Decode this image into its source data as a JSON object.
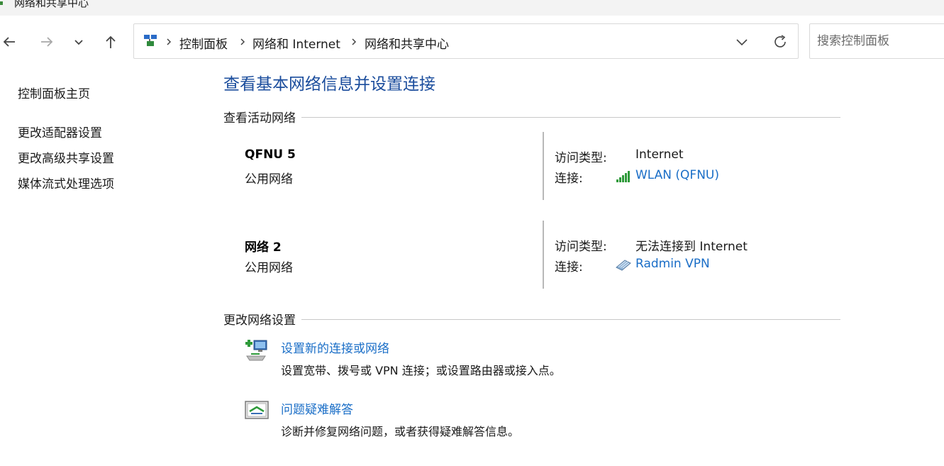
{
  "window": {
    "title": "网络和共享中心",
    "icon": "network-center-icon"
  },
  "nav": {
    "back_icon": "arrow-left-icon",
    "forward_icon": "arrow-right-icon",
    "recent_icon": "chevron-down-icon",
    "up_icon": "arrow-up-icon"
  },
  "address": {
    "icon": "control-panel-icon",
    "crumbs": [
      "控制面板",
      "网络和 Internet",
      "网络和共享中心"
    ],
    "dropdown_icon": "chevron-down-icon",
    "refresh_icon": "refresh-icon"
  },
  "search": {
    "placeholder": "搜索控制面板",
    "value": ""
  },
  "sidebar": {
    "home": "控制面板主页",
    "items": [
      "更改适配器设置",
      "更改高级共享设置",
      "媒体流式处理选项"
    ]
  },
  "main": {
    "heading": "查看基本网络信息并设置连接",
    "active_section": "查看活动网络",
    "networks": [
      {
        "name": "QFNU 5",
        "type": "公用网络",
        "access_label": "访问类型:",
        "access_value": "Internet",
        "connection_label": "连接:",
        "connection_name": "WLAN (QFNU)",
        "connection_icon": "wifi-signal-icon"
      },
      {
        "name": "网络 2",
        "type": "公用网络",
        "access_label": "访问类型:",
        "access_value": "无法连接到 Internet",
        "connection_label": "连接:",
        "connection_name": "Radmin VPN",
        "connection_icon": "ethernet-adapter-icon"
      }
    ],
    "change_section": "更改网络设置",
    "tasks": [
      {
        "icon": "new-connection-icon",
        "title": "设置新的连接或网络",
        "desc": "设置宽带、拨号或 VPN 连接；或设置路由器或接入点。"
      },
      {
        "icon": "troubleshoot-icon",
        "title": "问题疑难解答",
        "desc": "诊断并修复网络问题，或者获得疑难解答信息。"
      }
    ]
  },
  "colors": {
    "link": "#1a6ec7",
    "heading": "#1a4c9c",
    "signal": "#2e9a3a"
  }
}
